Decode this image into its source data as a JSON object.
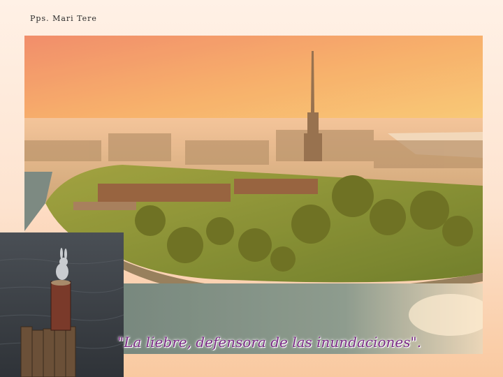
{
  "slide": {
    "credit": "Pps. Mari Tere",
    "caption": "\"La liebre, defensora de las inundaciones\"."
  },
  "colors": {
    "background": "#fde3cf",
    "caption": "#7a2b86",
    "sky": "#f4a96a",
    "water": "#6b8f8c",
    "park": "#7c9a2a"
  }
}
